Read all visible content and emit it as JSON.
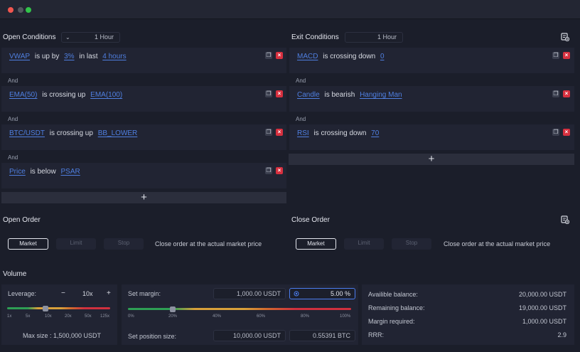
{
  "open_conditions": {
    "title": "Open Conditions",
    "timeframe": "1 Hour",
    "rows": [
      {
        "parts": [
          "VWAP",
          "is up by",
          "3%",
          "in last",
          "4 hours"
        ]
      },
      {
        "parts": [
          "EMA(50)",
          "is crossing up",
          "EMA(100)"
        ]
      },
      {
        "parts": [
          "BTC/USDT",
          "is crossing up",
          "BB_LOWER"
        ]
      },
      {
        "parts": [
          "Price",
          "is below",
          "PSAR"
        ]
      }
    ],
    "and_label": "And",
    "add_label": "+"
  },
  "exit_conditions": {
    "title": "Exit Conditions",
    "timeframe": "1 Hour",
    "rows": [
      {
        "parts": [
          "MACD",
          "is crossing down",
          "0"
        ]
      },
      {
        "parts": [
          "Candle",
          "is bearish",
          "Hanging Man"
        ]
      },
      {
        "parts": [
          "RSI",
          "is crossing down",
          "70"
        ]
      }
    ],
    "and_label": "And",
    "add_label": "+"
  },
  "open_order": {
    "title": "Open Order",
    "types": [
      "Market",
      "Limit",
      "Stop"
    ],
    "selected": "Market",
    "description": "Close order at the  actual market price"
  },
  "close_order": {
    "title": "Close Order",
    "types": [
      "Market",
      "Limit",
      "Stop"
    ],
    "selected": "Market",
    "description": "Close order at the  actual market price"
  },
  "volume": {
    "title": "Volume",
    "leverage": {
      "label": "Leverage:",
      "minus": "−",
      "plus": "+",
      "value": "10x",
      "ticks": [
        "1x",
        "5x",
        "10x",
        "20x",
        "50x",
        "125x"
      ],
      "slider_fraction": 0.375,
      "max_size": "Max size : 1,500,000 USDT"
    },
    "margin": {
      "label": "Set margin:",
      "amount": "1,000.00 USDT",
      "percent": "5.00 %",
      "ticks": [
        "0%",
        "20%",
        "40%",
        "60%",
        "80%",
        "100%"
      ],
      "slider_fraction": 0.2,
      "position_label": "Set position size:",
      "position_usdt": "10,000.00 USDT",
      "position_btc": "0.55391 BTC"
    },
    "balances": [
      {
        "label": "Availible balance:",
        "value": "20,000.00 USDT"
      },
      {
        "label": "Remaining balance:",
        "value": "19,000.00 USDT"
      },
      {
        "label": "Margin required:",
        "value": "1,000.00 USDT"
      },
      {
        "label": "RRR:",
        "value": "2.9"
      }
    ]
  },
  "colors": {
    "background": "#1b1e2a",
    "link": "#4f7fe0",
    "delete": "#d7303f",
    "accent": "#4b7df0"
  },
  "icons": [
    "copy-icon",
    "delete-icon",
    "chevron-down-icon",
    "add-rule-icon",
    "target-icon"
  ]
}
